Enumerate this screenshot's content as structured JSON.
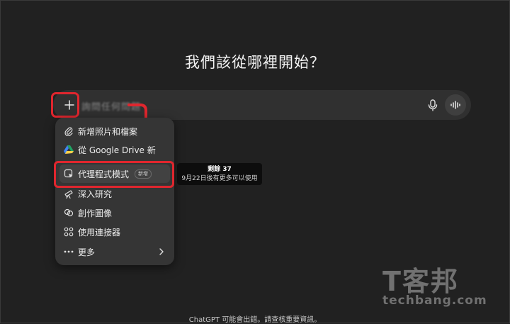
{
  "main": {
    "heading": "我們該從哪裡開始？"
  },
  "composer": {
    "placeholder": "詢問任何問題",
    "plus_icon": "plus-icon",
    "mic_icon": "microphone-icon",
    "voice_icon": "voice-waveform-icon"
  },
  "menu": {
    "items": [
      {
        "label": "新增照片和檔案",
        "icon": "paperclip-icon"
      },
      {
        "label": "從 Google Drive 新",
        "icon": "google-drive-icon"
      },
      {
        "label": "代理程式模式",
        "icon": "agent-cursor-icon",
        "badge": "新增"
      },
      {
        "label": "深入研究",
        "icon": "telescope-icon"
      },
      {
        "label": "創作圖像",
        "icon": "image-create-icon"
      },
      {
        "label": "使用連接器",
        "icon": "connectors-icon"
      },
      {
        "label": "更多",
        "icon": "ellipsis-icon"
      }
    ]
  },
  "tooltip": {
    "line1": "剩餘 37",
    "line2": "9月22日後有更多可以使用"
  },
  "footer": {
    "disclaimer": "ChatGPT 可能會出錯。請查核重要資訊。"
  },
  "watermark": {
    "logo": "T客邦",
    "url": "techbang.com"
  },
  "colors": {
    "background": "#212121",
    "composer": "#303030",
    "menu": "#353535",
    "highlight": "#e0262e"
  }
}
